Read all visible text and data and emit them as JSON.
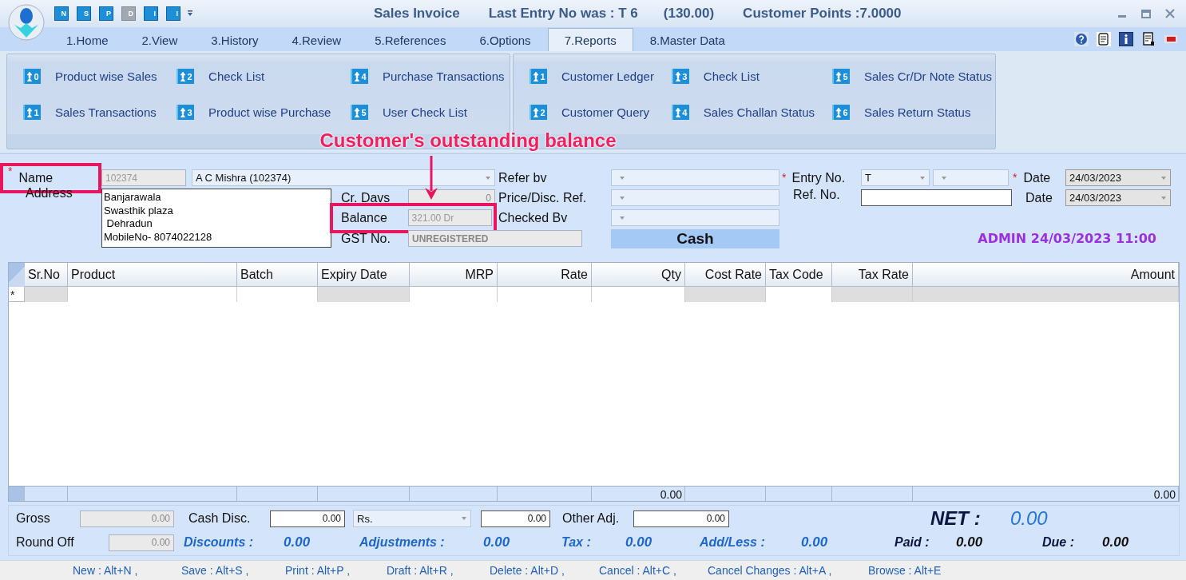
{
  "window": {
    "title": "Sales Invoice",
    "last_entry": "Last Entry No was : T 6",
    "last_amount": "(130.00)",
    "points": "Customer Points :7.0000"
  },
  "quick_toolbar": [
    {
      "glyph": "N",
      "disabled": false
    },
    {
      "glyph": "S",
      "disabled": false
    },
    {
      "glyph": "P",
      "disabled": false
    },
    {
      "glyph": "D",
      "disabled": true
    },
    {
      "glyph": "I",
      "disabled": false
    },
    {
      "glyph": "I",
      "disabled": false
    }
  ],
  "tabs": [
    {
      "label": "1.Home",
      "selected": false
    },
    {
      "label": "2.View",
      "selected": false
    },
    {
      "label": "3.History",
      "selected": false
    },
    {
      "label": "4.Review",
      "selected": false
    },
    {
      "label": "5.References",
      "selected": false
    },
    {
      "label": "6.Options",
      "selected": false
    },
    {
      "label": "7.Reports",
      "selected": true
    },
    {
      "label": "8.Master Data",
      "selected": false
    }
  ],
  "ribbon_groups": [
    {
      "items": [
        {
          "label": "Product wise Sales",
          "badge": "0"
        },
        {
          "label": "Sales Transactions",
          "badge": "1"
        },
        {
          "label": "Check List",
          "badge": "2"
        },
        {
          "label": "Product wise Purchase",
          "badge": "3"
        },
        {
          "label": "Purchase Transactions",
          "badge": "4"
        },
        {
          "label": "User Check List",
          "badge": "5"
        }
      ]
    },
    {
      "items": [
        {
          "label": "Customer Ledger",
          "badge": "1"
        },
        {
          "label": "Customer Query",
          "badge": "2"
        },
        {
          "label": "Check List",
          "badge": "3"
        },
        {
          "label": "Sales Challan Status",
          "badge": "4"
        },
        {
          "label": "Sales Cr/Dr Note Status",
          "badge": "5"
        },
        {
          "label": "Sales Return Status",
          "badge": "6"
        }
      ]
    }
  ],
  "annotation": {
    "text": "Customer's outstanding balance"
  },
  "form": {
    "name_label": "Name",
    "name_required": true,
    "name_highlighted": true,
    "customer_code": "102374",
    "customer_name": "A C Mishra (102374)",
    "address_label": "Address",
    "address_lines": [
      "Banjarawala",
      "Swasthik plaza",
      " Dehradun",
      "MobileNo- 8074022128"
    ],
    "cr_days_label": "Cr. Davs",
    "cr_days": "0",
    "balance_label": "Balance",
    "balance": "321.00 Dr",
    "balance_highlighted": true,
    "gst_label": "GST No.",
    "gst": "UNREGISTERED",
    "refer_by_label": "Refer bv",
    "price_ref_label": "Price/Disc. Ref.",
    "checked_by_label": "Checked Bv",
    "mode": "Cash",
    "entry_label": "Entry No.",
    "entry_required": true,
    "entry_series": "T",
    "ref_label": "Ref. No.",
    "date_label": "Date",
    "date_required": true,
    "date": "24/03/2023",
    "date2_label": "Date",
    "date2": "24/03/2023",
    "stamp": "ADMIN 24/03/2023 11:00"
  },
  "table": {
    "columns": [
      {
        "label": "Sr.No",
        "numeric": false,
        "readonly": true
      },
      {
        "label": "Product",
        "numeric": false,
        "readonly": false
      },
      {
        "label": "Batch",
        "numeric": false,
        "readonly": false
      },
      {
        "label": "Expiry Date",
        "numeric": false,
        "readonly": true
      },
      {
        "label": "MRP",
        "numeric": true,
        "readonly": false
      },
      {
        "label": "Rate",
        "numeric": true,
        "readonly": false
      },
      {
        "label": "Qty",
        "numeric": true,
        "readonly": false,
        "total": "0.00"
      },
      {
        "label": "Cost Rate",
        "numeric": true,
        "readonly": true
      },
      {
        "label": "Tax Code",
        "numeric": false,
        "readonly": false
      },
      {
        "label": "Tax Rate",
        "numeric": true,
        "readonly": true
      },
      {
        "label": "Amount",
        "numeric": true,
        "readonly": true,
        "total": "0.00"
      }
    ],
    "new_row_marker": "*"
  },
  "totals": {
    "gross_label": "Gross",
    "gross": "0.00",
    "cash_disc_label": "Cash Disc.",
    "cash_disc": "0.00",
    "disc_unit": "Rs.",
    "cash_disc_amount": "0.00",
    "other_adj_label": "Other Adj.",
    "other_adj": "0.00",
    "net_label": "NET :",
    "net": "0.00",
    "round_off_label": "Round Off",
    "round_off": "0.00",
    "discounts_label": "Discounts :",
    "discounts": "0.00",
    "adjustments_label": "Adjustments :",
    "adjustments": "0.00",
    "tax_label": "Tax :",
    "tax": "0.00",
    "add_less_label": "Add/Less :",
    "add_less": "0.00",
    "paid_label": "Paid :",
    "paid": "0.00",
    "due_label": "Due :",
    "due": "0.00"
  },
  "shortcuts": [
    "New : Alt+N ,",
    "Save : Alt+S ,",
    "Print : Alt+P ,",
    "Draft : Alt+R ,",
    "Delete : Alt+D ,",
    "Cancel : Alt+C ,",
    "Cancel Changes : Alt+A ,",
    "Browse : Alt+E"
  ]
}
